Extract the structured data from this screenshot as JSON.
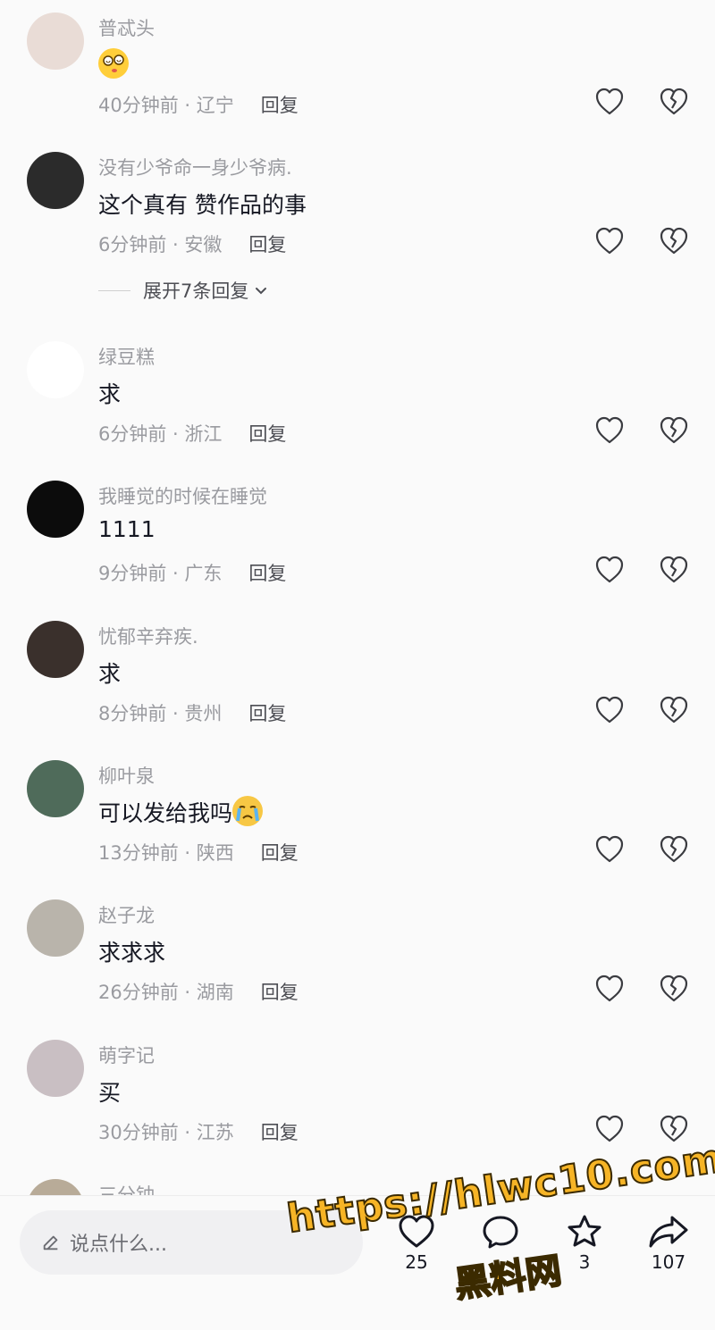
{
  "comments": [
    {
      "username": "普忒头",
      "content": "",
      "emoji": "dizzy",
      "time": "40分钟前",
      "location": "辽宁",
      "reply": "回复",
      "avatar_icon": "anime-avatar-icon",
      "avatar_bg": "#e9dcd6"
    },
    {
      "username": "没有少爷命一身少爷病.",
      "content": "这个真有 赞作品的事",
      "emoji": "",
      "time": "6分钟前",
      "location": "安徽",
      "reply": "回复",
      "avatar_icon": "person-avatar-icon",
      "avatar_bg": "#2b2b2b"
    },
    {
      "username": "绿豆糕",
      "content": "求",
      "emoji": "",
      "time": "6分钟前",
      "location": "浙江",
      "reply": "回复",
      "avatar_icon": "green-figure-avatar-icon",
      "avatar_bg": "#ffffff"
    },
    {
      "username": "我睡觉的时候在睡觉",
      "content": "1111",
      "emoji": "",
      "time": "9分钟前",
      "location": "广东",
      "reply": "回复",
      "avatar_icon": "black-cat-avatar-icon",
      "avatar_bg": "#0c0c0c"
    },
    {
      "username": "忧郁辛弃疾.",
      "content": "求",
      "emoji": "",
      "time": "8分钟前",
      "location": "贵州",
      "reply": "回复",
      "avatar_icon": "person-avatar-icon",
      "avatar_bg": "#3a302c"
    },
    {
      "username": "柳叶泉",
      "content": "可以发给我吗",
      "emoji": "crying",
      "time": "13分钟前",
      "location": "陕西",
      "reply": "回复",
      "avatar_icon": "person-avatar-icon",
      "avatar_bg": "#4f6b5a"
    },
    {
      "username": "赵子龙",
      "content": "求求求",
      "emoji": "",
      "time": "26分钟前",
      "location": "湖南",
      "reply": "回复",
      "avatar_icon": "cat-avatar-icon",
      "avatar_bg": "#b9b4ab"
    },
    {
      "username": "萌字记",
      "content": "买",
      "emoji": "",
      "time": "30分钟前",
      "location": "江苏",
      "reply": "回复",
      "avatar_icon": "portrait-avatar-icon",
      "avatar_bg": "#c9bfc3"
    },
    {
      "username": "三分钟",
      "content": "",
      "emoji": "",
      "time": "",
      "location": "",
      "reply": "",
      "avatar_icon": "partial-avatar-icon",
      "avatar_bg": "#b8ab98"
    }
  ],
  "expand_replies": {
    "label": "展开7条回复"
  },
  "bottom_bar": {
    "input_placeholder": "说点什么...",
    "like_count": "25",
    "comment_count": "",
    "favorite_count": "3",
    "share_count": "107"
  },
  "watermark": {
    "line1": "https://hlwc10.com",
    "line2": "黑料网",
    "color": "#f6b426"
  }
}
